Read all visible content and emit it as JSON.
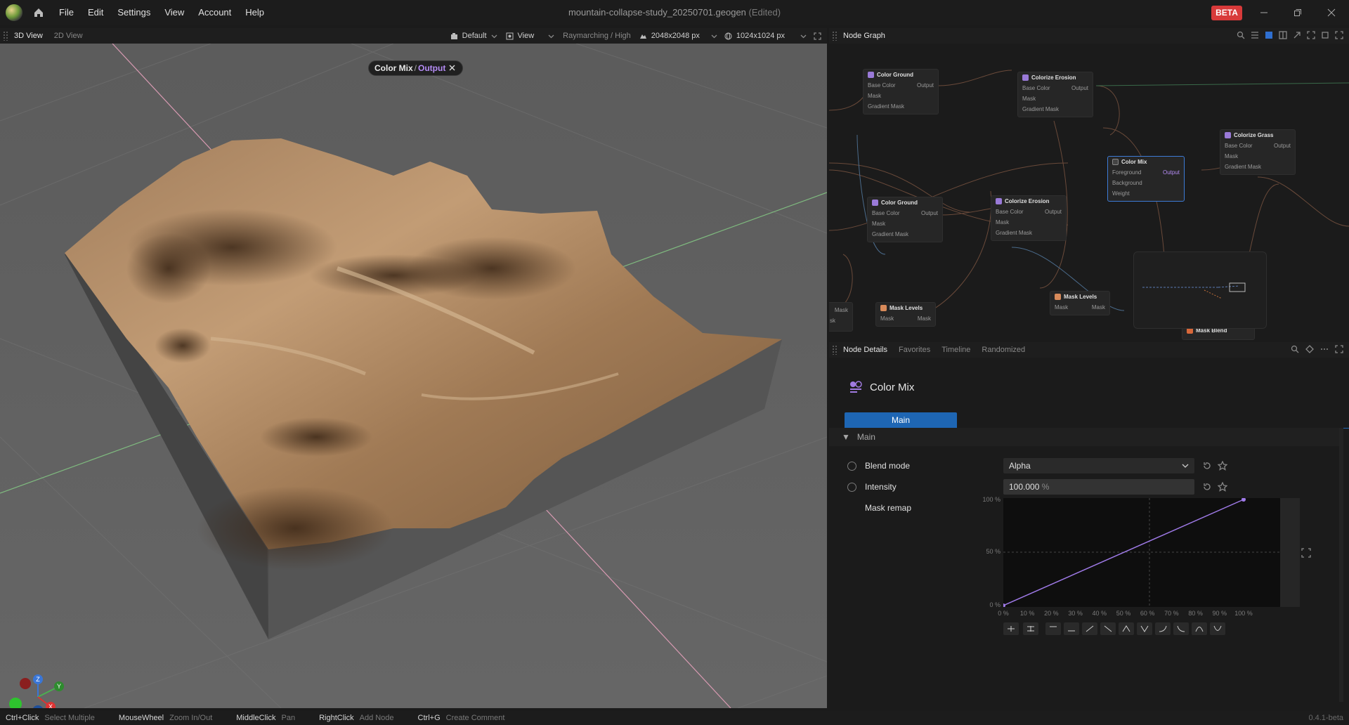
{
  "app": {
    "menu": [
      "File",
      "Edit",
      "Settings",
      "View",
      "Account",
      "Help"
    ],
    "document_title": "mountain-collapse-study_20250701.geogen",
    "edited_tag": "(Edited)",
    "beta_badge": "BETA"
  },
  "viewport_panel": {
    "tabs": [
      "3D View",
      "2D View"
    ],
    "camera_preset": "Default",
    "view_menu": "View",
    "render_mode": "Raymarching / High",
    "heightmap_resolution": "2048x2048 px",
    "texture_resolution": "1024x1024 px",
    "breadcrumb": {
      "node": "Color Mix",
      "separator": "/",
      "port": "Output"
    },
    "gizmo_axes": [
      "Z",
      "Y",
      "X"
    ]
  },
  "node_graph_panel": {
    "title": "Node Graph",
    "nodes": [
      {
        "title": "Color Ground",
        "inputs": [
          "Base Color",
          "Mask",
          "Gradient Mask"
        ],
        "output": "Output"
      },
      {
        "title": "Colorize Erosion",
        "inputs": [
          "Base Color",
          "Mask",
          "Gradient Mask"
        ],
        "output": "Output"
      },
      {
        "title": "Colorize Grass",
        "inputs": [
          "Base Color",
          "Mask",
          "Gradient Mask"
        ],
        "output": "Output"
      },
      {
        "title": "Color Mix",
        "inputs": [
          "Foreground",
          "Background",
          "Weight"
        ],
        "output": "Output"
      },
      {
        "title": "Color Ground",
        "inputs": [
          "Base Color",
          "Mask",
          "Gradient Mask"
        ],
        "output": "Output"
      },
      {
        "title": "Colorize Erosion",
        "inputs": [
          "Base Color",
          "Mask",
          "Gradient Mask"
        ],
        "output": "Output"
      },
      {
        "title": "Mask Levels",
        "inputs": [
          "Mask"
        ],
        "output": "Mask"
      },
      {
        "title": "Mask Levels",
        "inputs": [
          "Mask"
        ],
        "output": "Mask"
      },
      {
        "title": "Mask Blend",
        "inputs": [],
        "output": ""
      }
    ],
    "partial_labels": [
      "Mask",
      "sk"
    ]
  },
  "node_details_panel": {
    "tabs": [
      "Node Details",
      "Favorites",
      "Timeline",
      "Randomized"
    ],
    "node_name": "Color Mix",
    "page_tab": "Main",
    "section": "Main",
    "params": {
      "blend_mode_label": "Blend mode",
      "blend_mode_value": "Alpha",
      "intensity_label": "Intensity",
      "intensity_value": "100.000",
      "intensity_unit": "%",
      "mask_remap_label": "Mask remap"
    },
    "curve": {
      "y_ticks": [
        "100 %",
        "50 %",
        "0 %"
      ],
      "x_ticks": [
        "0 %",
        "10 %",
        "20 %",
        "30 %",
        "40 %",
        "50 %",
        "60 %",
        "70 %",
        "80 %",
        "90 %",
        "100 %"
      ],
      "points": [
        [
          0,
          0
        ],
        [
          100,
          100
        ]
      ],
      "curve_color": "#9f7ae8"
    }
  },
  "statusbar": {
    "hints": [
      {
        "key": "Ctrl+Click",
        "action": "Select Multiple"
      },
      {
        "key": "MouseWheel",
        "action": "Zoom In/Out"
      },
      {
        "key": "MiddleClick",
        "action": "Pan"
      },
      {
        "key": "RightClick",
        "action": "Add Node"
      },
      {
        "key": "Ctrl+G",
        "action": "Create Comment"
      }
    ],
    "version": "0.4.1-beta"
  },
  "colors": {
    "accent": "#1e66b4",
    "output_port": "#b58cf5",
    "beta": "#d83a3a"
  }
}
